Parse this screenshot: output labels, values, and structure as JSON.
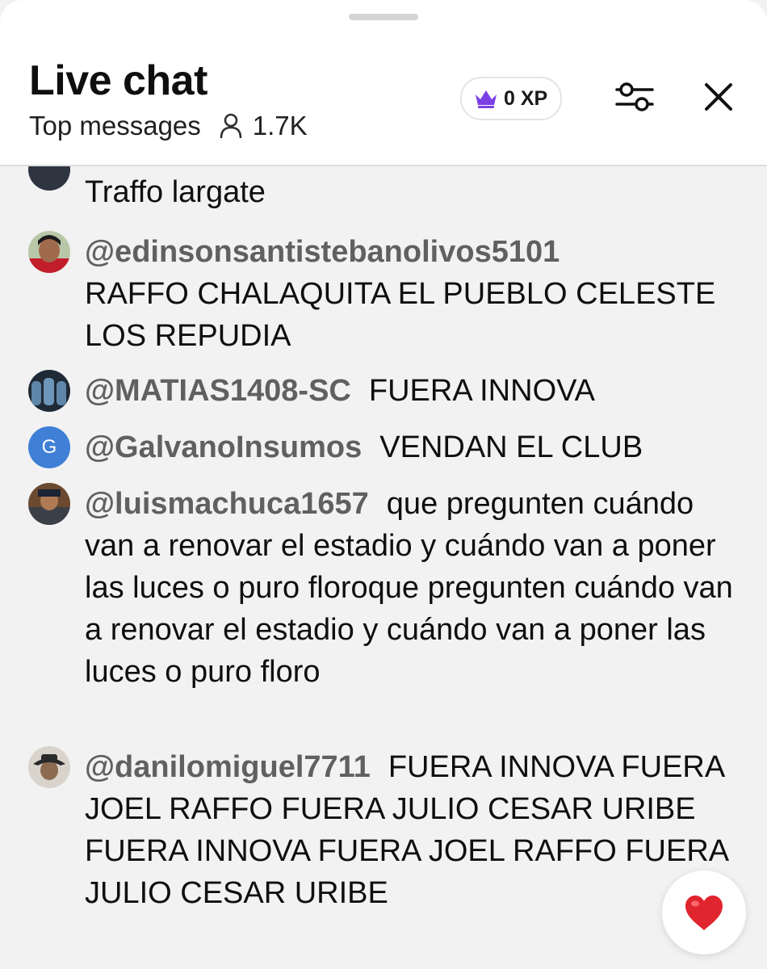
{
  "header": {
    "title": "Live chat",
    "mode_label": "Top messages",
    "viewer_count": "1.7K",
    "xp_label": "0 XP"
  },
  "colors": {
    "accent_crown": "#7b3fe4",
    "author_text": "#606060",
    "heart": "#e0252f",
    "avatar_g": "#3f7fd6"
  },
  "icons": {
    "crown": "crown-icon",
    "viewers": "person-icon",
    "filter": "sliders-icon",
    "close": "close-icon",
    "heart": "heart-icon"
  },
  "messages": [
    {
      "author": "",
      "text": "Traffo largate"
    },
    {
      "author": "@edinsonsantistebanolivos5101",
      "text": "RAFFO CHALAQUITA EL PUEBLO CELESTE LOS REPUDIA"
    },
    {
      "author": "@MATIAS1408-SC",
      "text": "FUERA INNOVA"
    },
    {
      "author": "@GalvanoInsumos",
      "text": "VENDAN EL CLUB",
      "avatar_letter": "G"
    },
    {
      "author": "@luismachuca1657",
      "text": "que pregunten cuándo van a renovar el estadio y cuándo van a poner las luces o puro floroque pregunten cuándo van a renovar el estadio y cuándo van a poner las luces o puro floro"
    },
    {
      "author": "@danilomiguel7711",
      "text": "FUERA INNOVA FUERA JOEL RAFFO FUERA JULIO CESAR URIBE FUERA INNOVA FUERA JOEL RAFFO FUERA JULIO CESAR URIBE"
    }
  ]
}
